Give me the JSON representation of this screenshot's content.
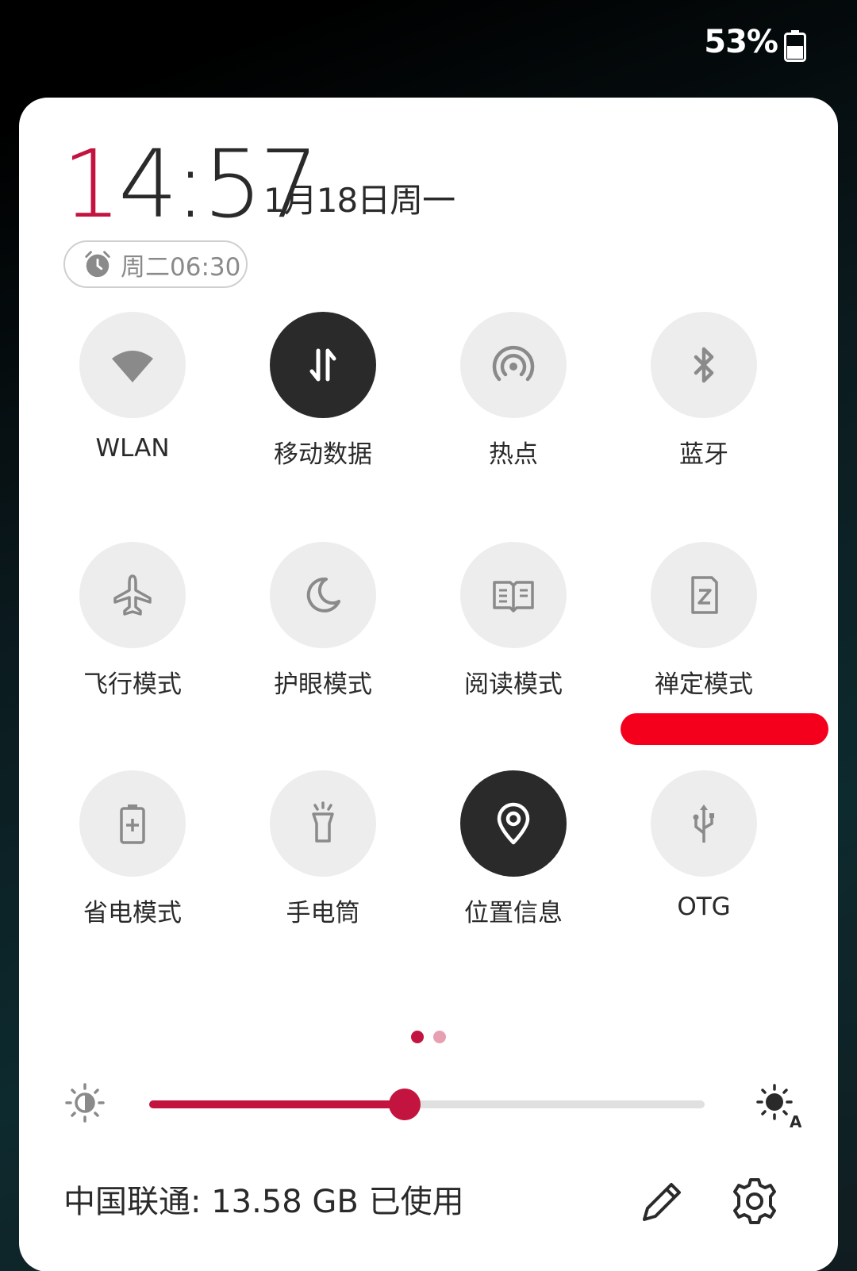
{
  "status_bar": {
    "battery_percent": "53%",
    "battery_icon": "battery-icon"
  },
  "panel": {
    "time_accent": "1",
    "time_rest": "4:57",
    "date": "1月18日周一",
    "alarm": {
      "label": "周二06:30",
      "icon": "alarm-clock-icon"
    },
    "tiles": [
      {
        "label": "WLAN",
        "icon": "wifi-icon",
        "active": false
      },
      {
        "label": "移动数据",
        "icon": "mobile-data-icon",
        "active": true
      },
      {
        "label": "热点",
        "icon": "hotspot-icon",
        "active": false
      },
      {
        "label": "蓝牙",
        "icon": "bluetooth-icon",
        "active": false
      },
      {
        "label": "飞行模式",
        "icon": "airplane-icon",
        "active": false
      },
      {
        "label": "护眼模式",
        "icon": "moon-icon",
        "active": false
      },
      {
        "label": "阅读模式",
        "icon": "book-icon",
        "active": false
      },
      {
        "label": "禅定模式",
        "icon": "zen-mode-icon",
        "active": false
      },
      {
        "label": "省电模式",
        "icon": "battery-saver-icon",
        "active": false
      },
      {
        "label": "手电筒",
        "icon": "flashlight-icon",
        "active": false
      },
      {
        "label": "位置信息",
        "icon": "location-pin-icon",
        "active": true
      },
      {
        "label": "OTG",
        "icon": "usb-icon",
        "active": false
      }
    ],
    "page_indicator": {
      "current": 1,
      "total": 2
    },
    "brightness": {
      "level": 0.46,
      "low_icon": "brightness-low-icon",
      "auto_icon": "brightness-auto-icon"
    },
    "footer": {
      "carrier_usage": "中国联通: 13.58 GB 已使用",
      "edit_icon": "pencil-icon",
      "settings_icon": "gear-icon"
    }
  },
  "colors": {
    "accent": "#c2143f",
    "tile_off": "#ededed",
    "tile_on": "#2a2a2a",
    "redaction": "#f5001c"
  }
}
